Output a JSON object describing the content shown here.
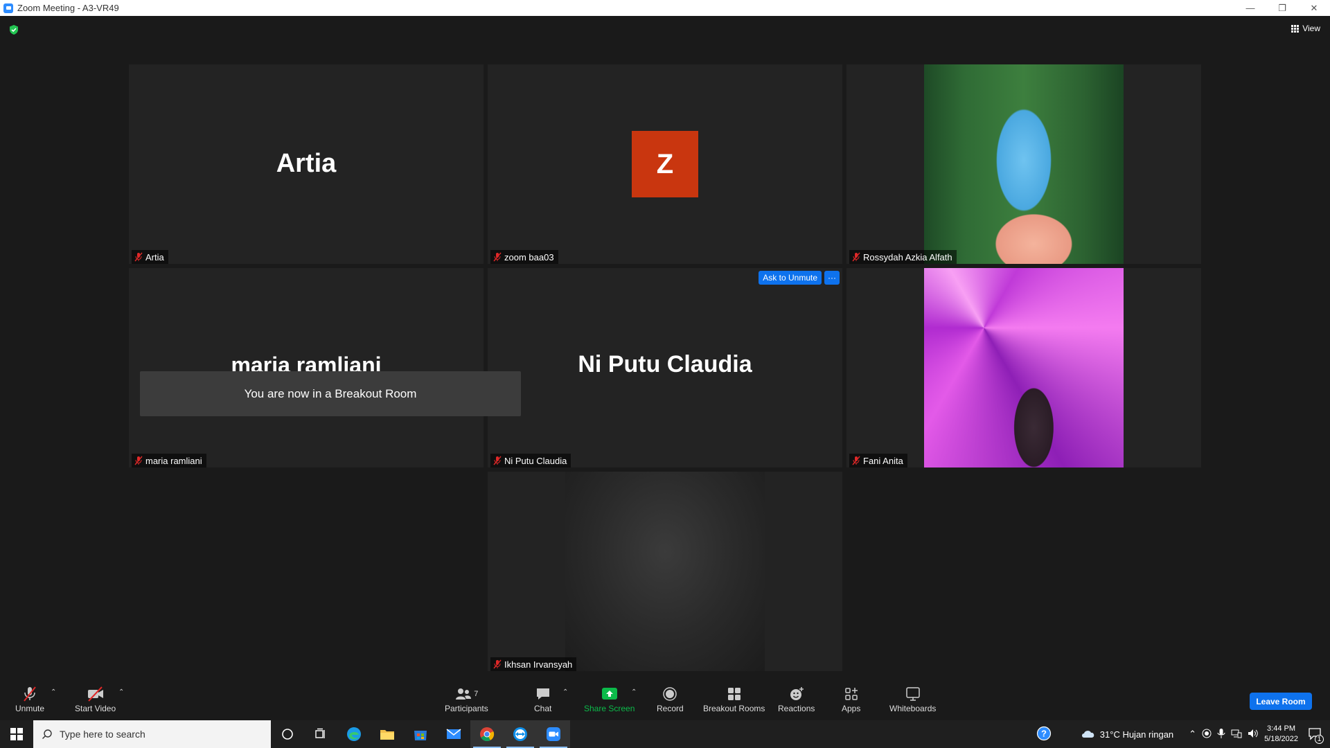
{
  "window": {
    "title": "Zoom Meeting - A3-VR49"
  },
  "header": {
    "view_label": "View"
  },
  "tiles": [
    {
      "display_name": "Artia",
      "label": "Artia"
    },
    {
      "avatar_letter": "Z",
      "label": "zoom baa03"
    },
    {
      "label": "Rossydah Azkia Alfath"
    },
    {
      "display_name": "maria ramliani",
      "label": "maria ramliani"
    },
    {
      "display_name": "Ni Putu Claudia",
      "label": "Ni Putu Claudia",
      "ask_unmute": "Ask to Unmute",
      "more": "···"
    },
    {
      "label": "Fani Anita"
    },
    {
      "label": "Ikhsan Irvansyah"
    }
  ],
  "toast": "You are now in a Breakout Room",
  "toolbar": {
    "unmute": "Unmute",
    "start_video": "Start Video",
    "participants": "Participants",
    "participants_count": "7",
    "chat": "Chat",
    "share_screen": "Share Screen",
    "record": "Record",
    "breakout_rooms": "Breakout Rooms",
    "reactions": "Reactions",
    "apps": "Apps",
    "whiteboards": "Whiteboards",
    "leave": "Leave Room"
  },
  "taskbar": {
    "search_placeholder": "Type here to search",
    "weather": "31°C  Hujan ringan",
    "time": "3:44 PM",
    "date": "5/18/2022",
    "notification_count": "1"
  },
  "colors": {
    "accent": "#0e72ed",
    "share_green": "#0cba4a",
    "avatar_bg": "#c9360f"
  }
}
